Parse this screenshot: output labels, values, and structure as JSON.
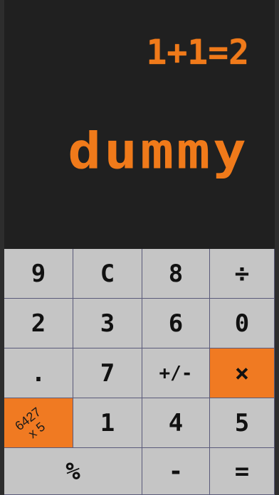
{
  "display": {
    "expression": "1+1=2",
    "result": "dummy"
  },
  "keys": {
    "k9": "9",
    "kC": "C",
    "k8": "8",
    "kdiv": "÷",
    "k2": "2",
    "k3": "3",
    "k6": "6",
    "k0": "0",
    "kdot": ".",
    "k7": "7",
    "ksign": "+/-",
    "kmul": "×",
    "promo_line1": "6427",
    "promo_line2": "x 5",
    "k1": "1",
    "k4": "4",
    "k5": "5",
    "kpct": "%",
    "kminus": "-",
    "keq": "="
  },
  "colors": {
    "accent": "#f07a22",
    "display_bg": "#202020",
    "key_bg": "#c5c5c5"
  }
}
